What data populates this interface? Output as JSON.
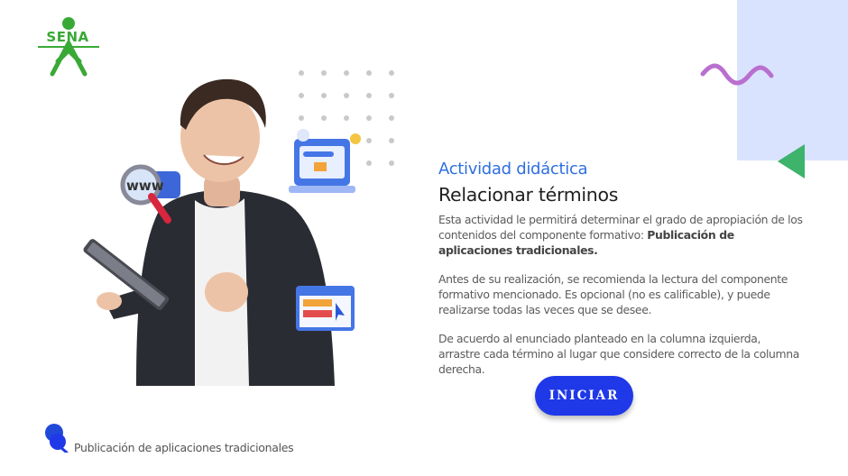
{
  "brand": {
    "logo_text": "SENA",
    "logo_color": "#39a936"
  },
  "content": {
    "kicker": "Actividad didáctica",
    "title": "Relacionar términos",
    "p1_text": "Esta actividad le permitirá determinar el grado de apropiación de los contenidos del componente formativo: ",
    "p1_bold": "Publicación de aplicaciones tradicionales.",
    "p2": "Antes de su realización, se recomienda la lectura del componente formativo mencionado.  Es opcional (no es calificable), y puede realizarse todas las veces que se desee.",
    "p3": "De acuerdo al enunciado planteado en la columna izquierda, arrastre cada término al lugar que considere correcto de la columna derecha."
  },
  "actions": {
    "start_label": "INICIAR"
  },
  "footer": {
    "label": "Publicación de aplicaciones tradicionales"
  },
  "colors": {
    "accent_blue": "#1f38e8",
    "kicker_blue": "#2f6fe0",
    "deco_block": "#dae3fd",
    "deco_triangle": "#3db36b",
    "deco_wave": "#b96fcf"
  },
  "icons": {
    "logo": "sena-logo-icon",
    "wave": "wave-decoration-icon",
    "triangle": "triangle-decoration-icon",
    "footer": "pushpin-icon"
  }
}
